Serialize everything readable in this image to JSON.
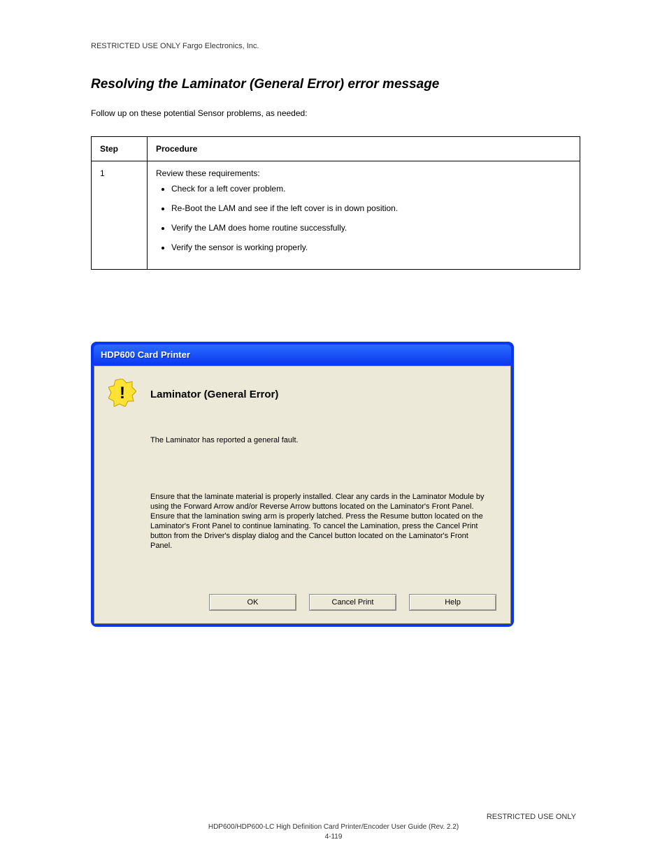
{
  "restricted_top": "RESTRICTED USE ONLY                                                                                                                                            Fargo Electronics, Inc.",
  "section_title": "Resolving the Laminator (General Error) error message",
  "followup": "Follow up on these potential Sensor problems, as needed:",
  "table": {
    "h0": "Step",
    "h1": "Procedure",
    "r0c0": "1",
    "r0c1_intro": "Review these requirements:",
    "bullets": [
      "Check for a left cover problem.",
      "Re-Boot the LAM and see if the left cover is in down position.",
      "Verify the LAM does home routine successfully.",
      "Verify the sensor is working properly."
    ]
  },
  "dialog": {
    "title": "HDP600 Card Printer",
    "error_title": "Laminator (General Error)",
    "message": "The Laminator has reported a general fault.",
    "long": "Ensure that the laminate material is properly installed. Clear any cards in the Laminator Module by using the Forward Arrow and/or Reverse Arrow buttons located on the Laminator's Front Panel. Ensure that the lamination swing arm is properly latched. Press the Resume button located on the Laminator's Front Panel to continue laminating. To cancel the Lamination, press the Cancel Print button from the Driver's display dialog and the Cancel button located on the Laminator's Front Panel.",
    "ok": "OK",
    "cancel": "Cancel Print",
    "help": "Help"
  },
  "footer": {
    "restricted": "RESTRICTED USE ONLY",
    "copy": "HDP600/HDP600-LC High Definition Card Printer/Encoder User Guide (Rev. 2.2)",
    "page": "4-119"
  }
}
